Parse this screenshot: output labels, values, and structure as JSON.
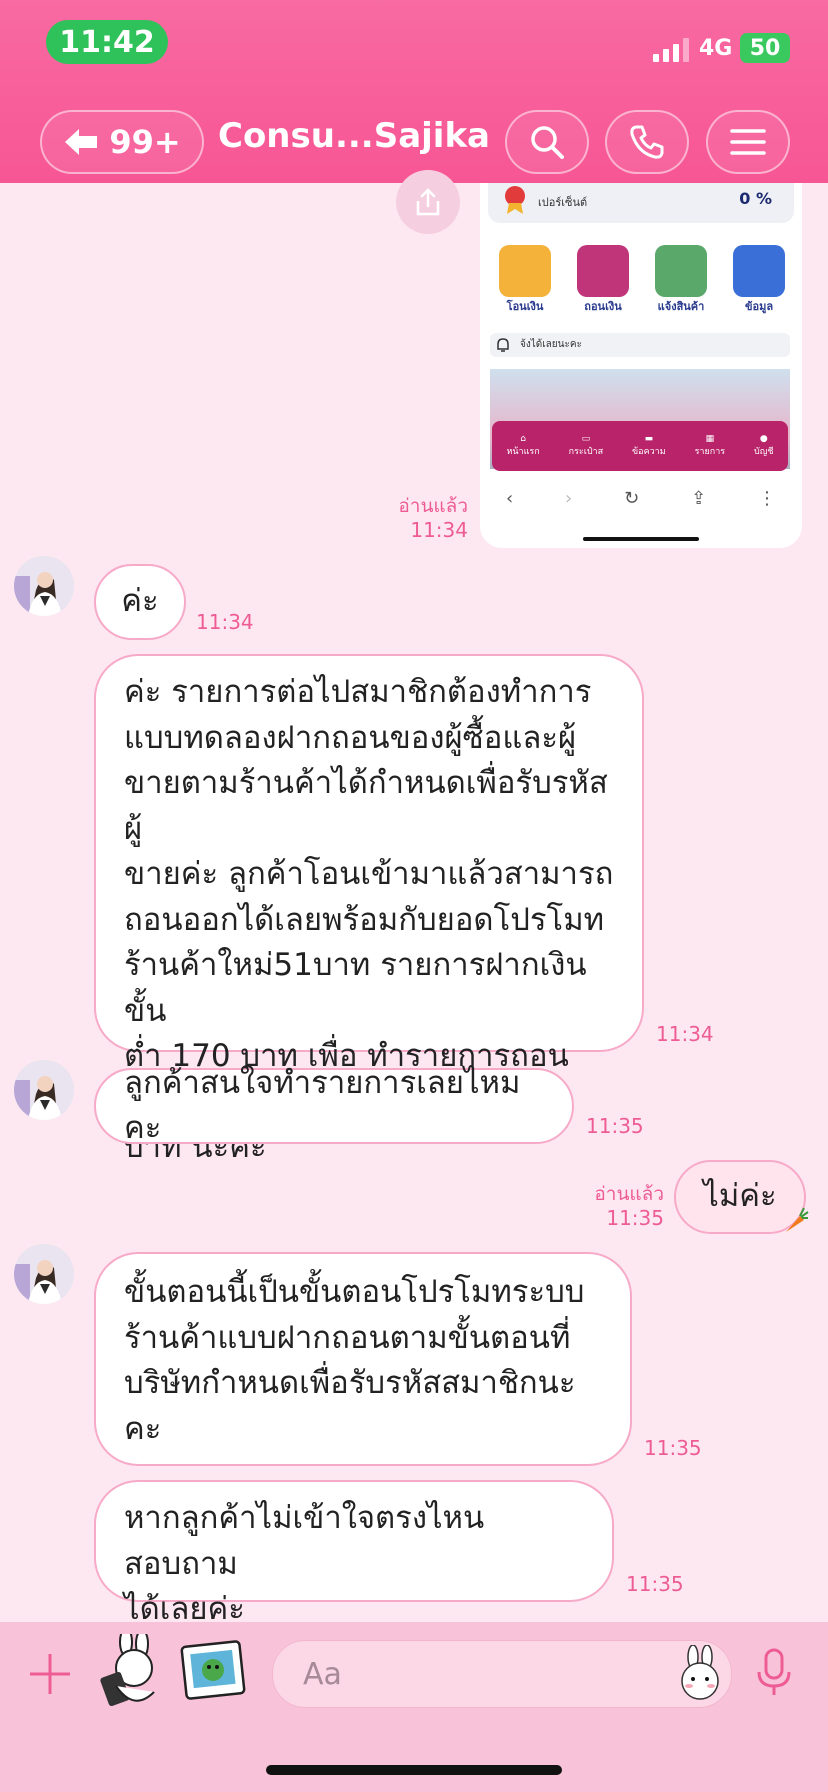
{
  "status_bar": {
    "time": "11:42",
    "network": "4G",
    "battery": "50"
  },
  "header": {
    "back_count": "99+",
    "title": "Consu...Sajika"
  },
  "shared_image": {
    "percent_label": "เปอร์เซ็นต์",
    "percent_value": "0 %",
    "actions": [
      {
        "label": "โอนเงิน",
        "icon": "coin-icon",
        "color": "#f5b23a"
      },
      {
        "label": "ถอนเงิน",
        "icon": "card-icon",
        "color": "#c0357a"
      },
      {
        "label": "แจ้งสินค้า",
        "icon": "shield-icon",
        "color": "#5aa86a"
      },
      {
        "label": "ข้อมูล",
        "icon": "briefcase-icon",
        "color": "#3a6fd8"
      }
    ],
    "notice": "จ้งได้เลยนะคะ",
    "nav": [
      {
        "label": "หน้าแรก",
        "icon": "home-icon"
      },
      {
        "label": "กระเป๋าส",
        "icon": "wallet-icon"
      },
      {
        "label": "ข้อความ",
        "icon": "message-icon"
      },
      {
        "label": "รายการ",
        "icon": "list-icon"
      },
      {
        "label": "บัญชี",
        "icon": "account-icon"
      }
    ],
    "nav_color": "#b8236a"
  },
  "messages": {
    "m0": {
      "read": "อ่านแล้ว",
      "time": "11:34"
    },
    "m1": {
      "text": "ค่ะ",
      "time": "11:34"
    },
    "m2": {
      "lines": [
        "ค่ะ รายการต่อไปสมาชิกต้องทำการ",
        "แบบทดลองฝากถอนของผู้ซื้อและผู้",
        "ขายตามร้านค้าได้กำหนดเพื่อรับรหัสผู้",
        "ขายค่ะ ลูกค้าโอนเข้ามาแล้วสามารถ",
        "ถอนออกได้เลยพร้อมกับยอดโปรโมท",
        "ร้านค้าใหม่51บาท รายการฝากเงินขั้น",
        "ต่ำ 170 บาท เพื่อ ทำรายการถอน 221",
        "บาท นะคะ"
      ],
      "time": "11:34"
    },
    "m3": {
      "text": "ลูกค้าสนใจทำรายการเลยไหมคะ",
      "time": "11:35"
    },
    "m4": {
      "text": "ไม่ค่ะ",
      "read": "อ่านแล้ว",
      "time": "11:35"
    },
    "m5": {
      "lines": [
        "ขั้นตอนนี้เป็นขั้นตอนโปรโมทระบบ",
        "ร้านค้าแบบฝากถอนตามขั้นตอนที่",
        "บริษัทกำหนดเพื่อรับรหัสสมาชิกนะคะ"
      ],
      "time": "11:35"
    },
    "m6": {
      "lines": [
        "หากลูกค้าไม่เข้าใจตรงไหนสอบถาม",
        "ได้เลยค่ะ"
      ],
      "time": "11:35"
    }
  },
  "composer": {
    "placeholder": "Aa"
  },
  "colors": {
    "header": "#f75694",
    "accent": "#ee5c95",
    "bubble_border": "#f7a9c8"
  }
}
